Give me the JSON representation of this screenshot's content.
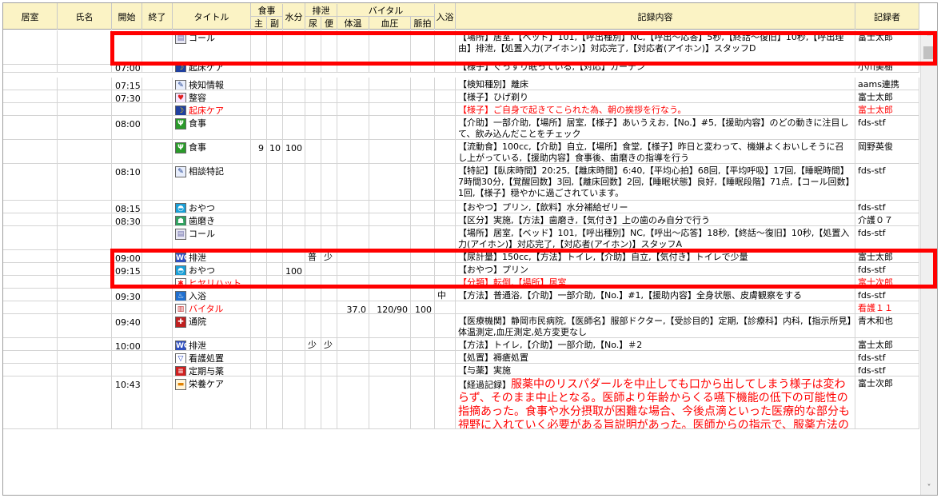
{
  "header": {
    "room": "居室",
    "name": "氏名",
    "start": "開始",
    "end": "終了",
    "title": "タイトル",
    "meal": "食事",
    "meal_main": "主",
    "meal_side": "副",
    "water": "水分",
    "excretion": "排泄",
    "urine": "尿",
    "stool": "便",
    "vital": "バイタル",
    "temp": "体温",
    "bp": "血圧",
    "pulse": "脈拍",
    "bath": "入浴",
    "record": "記録内容",
    "recorder": "記録者"
  },
  "rows": [
    {
      "start": "",
      "icon": "memo-icon",
      "title": "コール",
      "title_red": false,
      "meal_main": "",
      "meal_side": "",
      "water": "",
      "urine": "",
      "stool": "",
      "temp": "",
      "bp": "",
      "pulse": "",
      "bath": "",
      "record": "【場所】居室,【ベッド】101,【呼出種別】NC,【呼出～応答】5秒,【終話～復旧】10秒,【呼出理由】排泄,【処置入力(アイホン)】対応完了,【対応者(アイホン)】スタッフD",
      "record_red": false,
      "record_big": false,
      "recorder": "富士太郎",
      "recorder_red": false
    },
    {
      "start": "07:00",
      "icon": "wake-icon",
      "title": "起床ケア",
      "title_red": false,
      "meal_main": "",
      "meal_side": "",
      "water": "",
      "urine": "",
      "stool": "",
      "temp": "",
      "bp": "",
      "pulse": "",
      "bath": "",
      "record": "【様子】ぐっすり眠っている,【対応】カーテン",
      "record_red": false,
      "record_big": false,
      "recorder": "小川美樹",
      "recorder_red": false
    },
    {
      "start": "07:15",
      "icon": "pencil-icon",
      "title": "検知情報",
      "title_red": false,
      "meal_main": "",
      "meal_side": "",
      "water": "",
      "urine": "",
      "stool": "",
      "temp": "",
      "bp": "",
      "pulse": "",
      "bath": "",
      "record": "【検知種別】離床",
      "record_red": false,
      "record_big": false,
      "recorder": "aams連携",
      "recorder_red": false
    },
    {
      "start": "07:30",
      "icon": "grooming-icon",
      "title": "整容",
      "title_red": false,
      "meal_main": "",
      "meal_side": "",
      "water": "",
      "urine": "",
      "stool": "",
      "temp": "",
      "bp": "",
      "pulse": "",
      "bath": "",
      "record": "【様子】ひげ剃り",
      "record_red": false,
      "record_big": false,
      "recorder": "富士太郎",
      "recorder_red": false
    },
    {
      "start": "",
      "icon": "wake-icon",
      "title": "起床ケア",
      "title_red": true,
      "meal_main": "",
      "meal_side": "",
      "water": "",
      "urine": "",
      "stool": "",
      "temp": "",
      "bp": "",
      "pulse": "",
      "bath": "",
      "record": "【様子】ご自身で起きてこられた為、朝の挨拶を行なう。",
      "record_red": true,
      "record_big": false,
      "recorder": "富士太郎",
      "recorder_red": true
    },
    {
      "start": "08:00",
      "icon": "meal-icon",
      "title": "食事",
      "title_red": false,
      "meal_main": "",
      "meal_side": "",
      "water": "",
      "urine": "",
      "stool": "",
      "temp": "",
      "bp": "",
      "pulse": "",
      "bath": "",
      "record": "【介助】一部介助,【場所】居室,【様子】あいうえお,【No.】#5,【援助内容】のどの動きに注目して、飲み込んだことをチェック",
      "record_red": false,
      "record_big": false,
      "recorder": "fds-stf",
      "recorder_red": false
    },
    {
      "start": "",
      "icon": "meal-icon",
      "title": "食事",
      "title_red": false,
      "meal_main": "9",
      "meal_side": "10",
      "water": "100",
      "urine": "",
      "stool": "",
      "temp": "",
      "bp": "",
      "pulse": "",
      "bath": "",
      "record": "【流動食】100cc,【介助】自立,【場所】食堂,【様子】昨日と変わって、機嫌よくおいしそうに召し上がっている,【援助内容】食事後、歯磨きの指導を行う",
      "record_red": false,
      "record_big": false,
      "recorder": "岡野英俊",
      "recorder_red": false
    },
    {
      "start": "08:10",
      "icon": "pencil-icon",
      "title": "相談特記",
      "title_red": false,
      "meal_main": "",
      "meal_side": "",
      "water": "",
      "urine": "",
      "stool": "",
      "temp": "",
      "bp": "",
      "pulse": "",
      "bath": "",
      "record": "【特記】【臥床時間】20:25,【離床時間】6:40,【平均心拍】68回,【平均呼吸】17回,【睡眠時間】7時間30分,【覚醒回数】3回,【離床回数】2回,【睡眠状態】良好,【睡眠段階】71点,【コール回数】1回,【様子】穏やかに過ごされています。",
      "record_red": false,
      "record_big": false,
      "recorder": "fds-stf",
      "recorder_red": false
    },
    {
      "start": "08:15",
      "icon": "snack-icon",
      "title": "おやつ",
      "title_red": false,
      "meal_main": "",
      "meal_side": "",
      "water": "",
      "urine": "",
      "stool": "",
      "temp": "",
      "bp": "",
      "pulse": "",
      "bath": "",
      "record": "【おやつ】プリン,【飲料】水分補給ゼリー",
      "record_red": false,
      "record_big": false,
      "recorder": "fds-stf",
      "recorder_red": false
    },
    {
      "start": "08:30",
      "icon": "tooth-icon",
      "title": "歯磨き",
      "title_red": false,
      "meal_main": "",
      "meal_side": "",
      "water": "",
      "urine": "",
      "stool": "",
      "temp": "",
      "bp": "",
      "pulse": "",
      "bath": "",
      "record": "【区分】実施,【方法】歯磨き,【気付き】上の歯のみ自分で行う",
      "record_red": false,
      "record_big": false,
      "recorder": "介護０７",
      "recorder_red": false
    },
    {
      "start": "",
      "icon": "memo-icon",
      "title": "コール",
      "title_red": false,
      "meal_main": "",
      "meal_side": "",
      "water": "",
      "urine": "",
      "stool": "",
      "temp": "",
      "bp": "",
      "pulse": "",
      "bath": "",
      "record": "【場所】居室,【ベッド】101,【呼出種別】NC,【呼出～応答】18秒,【終話～復旧】10秒,【処置入力(アイホン)】対応完了,【対応者(アイホン)】スタッフA",
      "record_red": false,
      "record_big": false,
      "recorder": "fds-stf",
      "recorder_red": false
    },
    {
      "start": "09:00",
      "icon": "toilet-icon",
      "title": "排泄",
      "title_red": false,
      "meal_main": "",
      "meal_side": "",
      "water": "",
      "urine": "普",
      "stool": "少",
      "temp": "",
      "bp": "",
      "pulse": "",
      "bath": "",
      "record": "【尿計量】150cc,【方法】トイレ,【介助】自立,【気付き】トイレで少量",
      "record_red": false,
      "record_big": false,
      "recorder": "富士太郎",
      "recorder_red": false
    },
    {
      "start": "09:15",
      "icon": "snack-icon",
      "title": "おやつ",
      "title_red": false,
      "meal_main": "",
      "meal_side": "",
      "water": "100",
      "urine": "",
      "stool": "",
      "temp": "",
      "bp": "",
      "pulse": "",
      "bath": "",
      "record": "【おやつ】プリン",
      "record_red": false,
      "record_big": false,
      "recorder": "fds-stf",
      "recorder_red": false
    },
    {
      "start": "",
      "icon": "hiyari-icon",
      "title": "ヒヤリハット",
      "title_red": true,
      "meal_main": "",
      "meal_side": "",
      "water": "",
      "urine": "",
      "stool": "",
      "temp": "",
      "bp": "",
      "pulse": "",
      "bath": "",
      "record": "【分類】転倒,【場所】居室",
      "record_red": true,
      "record_big": false,
      "recorder": "富士次郎",
      "recorder_red": true
    },
    {
      "start": "09:30",
      "icon": "bath-icon",
      "title": "入浴",
      "title_red": false,
      "meal_main": "",
      "meal_side": "",
      "water": "",
      "urine": "",
      "stool": "",
      "temp": "",
      "bp": "",
      "pulse": "",
      "bath": "中止",
      "record": "【方法】普通浴,【介助】一部介助,【No.】#1,【援助内容】全身状態、皮膚観察をする",
      "record_red": false,
      "record_big": false,
      "recorder": "fds-stf",
      "recorder_red": false
    },
    {
      "start": "",
      "icon": "vital-icon",
      "title": "バイタル",
      "title_red": true,
      "meal_main": "",
      "meal_side": "",
      "water": "",
      "urine": "",
      "stool": "",
      "temp": "37.0",
      "bp": "120/90",
      "pulse": "100",
      "bath": "",
      "record": "",
      "record_red": true,
      "record_big": false,
      "recorder": "看護１１",
      "recorder_red": true
    },
    {
      "start": "09:40",
      "icon": "hospital-icon",
      "title": "通院",
      "title_red": false,
      "meal_main": "",
      "meal_side": "",
      "water": "",
      "urine": "",
      "stool": "",
      "temp": "",
      "bp": "",
      "pulse": "",
      "bath": "",
      "record": "【医療機関】静岡市民病院,【医師名】服部ドクター,【受診目的】定期,【診療科】内科,【指示所見】体温測定,血圧測定,処方変更なし",
      "record_red": false,
      "record_big": false,
      "recorder": "青木和也",
      "recorder_red": false
    },
    {
      "start": "10:00",
      "icon": "toilet-icon",
      "title": "排泄",
      "title_red": false,
      "meal_main": "",
      "meal_side": "",
      "water": "",
      "urine": "少",
      "stool": "少",
      "temp": "",
      "bp": "",
      "pulse": "",
      "bath": "",
      "record": "【方法】トイレ,【介助】一部介助,【No.】＃2",
      "record_red": false,
      "record_big": false,
      "recorder": "富士太郎",
      "recorder_red": false
    },
    {
      "start": "",
      "icon": "nursing-icon",
      "title": "看護処置",
      "title_red": false,
      "meal_main": "",
      "meal_side": "",
      "water": "",
      "urine": "",
      "stool": "",
      "temp": "",
      "bp": "",
      "pulse": "",
      "bath": "",
      "record": "【処置】褥瘡処置",
      "record_red": false,
      "record_big": false,
      "recorder": "fds-stf",
      "recorder_red": false
    },
    {
      "start": "",
      "icon": "medicine-icon",
      "title": "定期与薬",
      "title_red": false,
      "meal_main": "",
      "meal_side": "",
      "water": "",
      "urine": "",
      "stool": "",
      "temp": "",
      "bp": "",
      "pulse": "",
      "bath": "",
      "record": "【与薬】実施",
      "record_red": false,
      "record_big": false,
      "recorder": "fds-stf",
      "recorder_red": false
    },
    {
      "start": "10:43",
      "icon": "nutrition-icon",
      "title": "栄養ケア",
      "title_red": false,
      "meal_main": "",
      "meal_side": "",
      "water": "",
      "urine": "",
      "stool": "",
      "temp": "",
      "bp": "",
      "pulse": "",
      "bath": "",
      "record_label": "【経過記録】",
      "record": "服薬中のリスパダールを中止しても口から出してしまう様子は変わらず、そのまま中止となる。医師より年齢からくる嚥下機能の低下の可能性の指摘あった。食事や水分摂取が困難な場合、今後点滴といった医療的な部分も視野に入れていく必要がある旨説明があった。医師からの指示で、服薬方法の工夫について試行し結果を",
      "record_red": true,
      "record_big": true,
      "recorder": "富士次郎",
      "recorder_red": false
    }
  ],
  "icons": {
    "memo-icon": {
      "glyph": "▤",
      "color": "#6a6aa8",
      "bg": "#e8e8f4"
    },
    "wake-icon": {
      "glyph": "☽",
      "color": "#ffd400",
      "bg": "#2040a0"
    },
    "pencil-icon": {
      "glyph": "✎",
      "color": "#1a3c8c",
      "bg": "#e8eefc"
    },
    "grooming-icon": {
      "glyph": "♥",
      "color": "#e02020",
      "bg": "#f6e6ff"
    },
    "meal-icon": {
      "glyph": "Ψ",
      "color": "#ffffff",
      "bg": "#2a9a2a"
    },
    "snack-icon": {
      "glyph": "◓",
      "color": "#ffffff",
      "bg": "#1aa0d8"
    },
    "tooth-icon": {
      "glyph": "☗",
      "color": "#ffffff",
      "bg": "#30a060"
    },
    "toilet-icon": {
      "glyph": "WC",
      "color": "#ffffff",
      "bg": "#3050c0"
    },
    "hiyari-icon": {
      "glyph": "✱",
      "color": "#ff1010",
      "bg": "#ffffff"
    },
    "bath-icon": {
      "glyph": "♨",
      "color": "#ffffff",
      "bg": "#2070d0"
    },
    "vital-icon": {
      "glyph": "▥",
      "color": "#c02020",
      "bg": "#ffffff"
    },
    "hospital-icon": {
      "glyph": "✚",
      "color": "#ffffff",
      "bg": "#c02020"
    },
    "nursing-icon": {
      "glyph": "▽",
      "color": "#2040c0",
      "bg": "#ffffff"
    },
    "medicine-icon": {
      "glyph": "≡",
      "color": "#ffffff",
      "bg": "#d02020"
    },
    "nutrition-icon": {
      "glyph": "▬",
      "color": "#e08000",
      "bg": "#fff4d8"
    }
  },
  "colors": {
    "header_bg": "#fbf3c5",
    "highlight": "#ff0000",
    "record_red": "#ff0000"
  },
  "scroll": {
    "up_arrow": "˄",
    "down_arrow": "˅"
  }
}
